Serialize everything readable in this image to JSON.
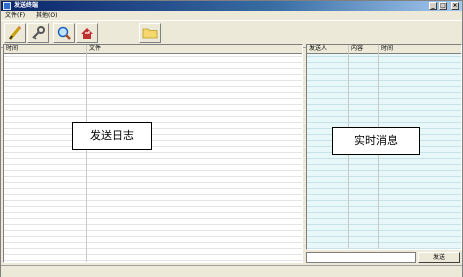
{
  "window": {
    "title": "发送终端"
  },
  "titlebar_buttons": {
    "minimize": "_",
    "maximize": "□",
    "close": "×"
  },
  "menu": [
    {
      "label": "文件(F)"
    },
    {
      "label": "其他(O)"
    }
  ],
  "toolbar": [
    {
      "icon": "pencil-icon"
    },
    {
      "icon": "key-icon"
    },
    {
      "icon": "search-icon"
    },
    {
      "icon": "send-icon"
    },
    {
      "icon": "folder-icon"
    }
  ],
  "log_panel": {
    "columns": [
      "时间",
      "文件"
    ],
    "caption": "发送日志"
  },
  "message_panel": {
    "columns": [
      "发送人",
      "内容",
      "时间"
    ],
    "caption": "实时消息",
    "send_label": "发送"
  },
  "colors": {
    "title_gradient_start": "#0a246a",
    "title_gradient_end": "#a6caf0",
    "message_bg": "#e8f8f8"
  }
}
